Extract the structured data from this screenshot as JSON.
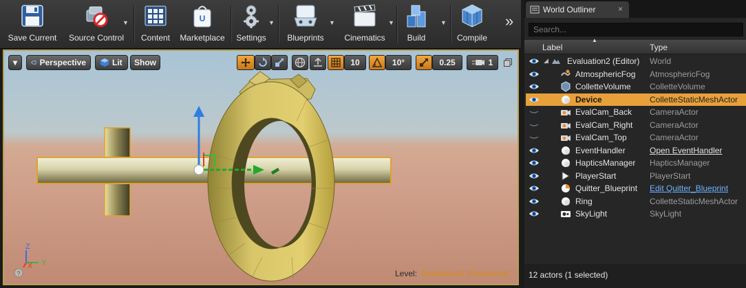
{
  "toolbar": {
    "buttons": [
      {
        "label": "Save Current",
        "icon": "save-icon"
      },
      {
        "label": "Source Control",
        "icon": "source-control-icon"
      },
      {
        "label": "Content",
        "icon": "content-browser-icon"
      },
      {
        "label": "Marketplace",
        "icon": "marketplace-icon"
      },
      {
        "label": "Settings",
        "icon": "settings-icon"
      },
      {
        "label": "Blueprints",
        "icon": "blueprints-icon"
      },
      {
        "label": "Cinematics",
        "icon": "cinematics-icon"
      },
      {
        "label": "Build",
        "icon": "build-icon"
      },
      {
        "label": "Compile",
        "icon": "compile-icon"
      }
    ],
    "overflow": "»"
  },
  "viewport": {
    "menu_arrow": "▾",
    "perspective": "Perspective",
    "lit": "Lit",
    "show": "Show",
    "grid_snap": "10",
    "angle_snap": "10°",
    "scale_snap": "0.25",
    "camera_speed": "1",
    "axis": {
      "z": "Z",
      "x": "X",
      "y": "Y"
    },
    "help": "?",
    "level_label": "Level:",
    "level_name": "Evaluation2 (Persistent)",
    "colors": {
      "level_name": "#d68b1b",
      "selection": "#e8a03a"
    }
  },
  "outliner": {
    "tab_title": "World Outliner",
    "tab_close": "×",
    "search_placeholder": "Search...",
    "col_label": "Label",
    "col_type": "Type",
    "rows": [
      {
        "label": "Evaluation2 (Editor)",
        "type": "World",
        "icon": "world-icon",
        "visible": true,
        "expandable": true,
        "root": true
      },
      {
        "label": "AtmosphericFog",
        "type": "AtmosphericFog",
        "icon": "fog-icon",
        "visible": true
      },
      {
        "label": "ColletteVolume",
        "type": "ColletteVolume",
        "icon": "volume-icon",
        "visible": true
      },
      {
        "label": "Device",
        "type": "ColletteStaticMeshActor",
        "icon": "sphere-icon",
        "visible": true,
        "selected": true
      },
      {
        "label": "EvalCam_Back",
        "type": "CameraActor",
        "icon": "camera-icon",
        "visible": false
      },
      {
        "label": "EvalCam_Right",
        "type": "CameraActor",
        "icon": "camera-icon",
        "visible": false
      },
      {
        "label": "EvalCam_Top",
        "type": "CameraActor",
        "icon": "camera-icon",
        "visible": false
      },
      {
        "label": "EventHandler",
        "type": "Open EventHandler",
        "icon": "sphere-icon",
        "visible": true,
        "type_link": "plain"
      },
      {
        "label": "HapticsManager",
        "type": "HapticsManager",
        "icon": "sphere-icon",
        "visible": true
      },
      {
        "label": "PlayerStart",
        "type": "PlayerStart",
        "icon": "player-start-icon",
        "visible": true
      },
      {
        "label": "Quitter_Blueprint",
        "type": "Edit Quitter_Blueprint",
        "icon": "blueprint-actor-icon",
        "visible": true,
        "type_link": "blue"
      },
      {
        "label": "Ring",
        "type": "ColletteStaticMeshActor",
        "icon": "sphere-icon",
        "visible": true
      },
      {
        "label": "SkyLight",
        "type": "SkyLight",
        "icon": "skylight-icon",
        "visible": true
      }
    ],
    "status": "12 actors (1 selected)"
  }
}
